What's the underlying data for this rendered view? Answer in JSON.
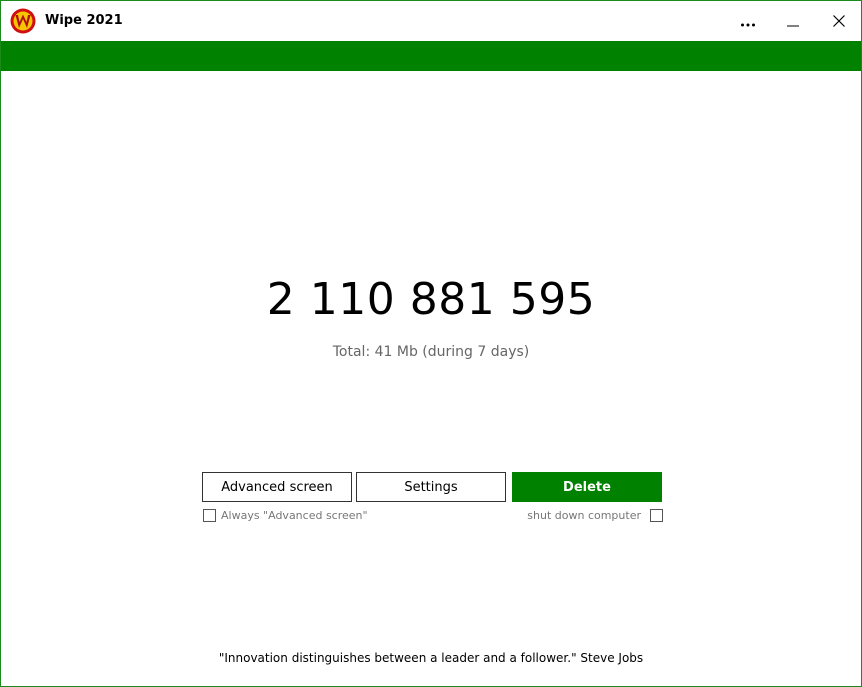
{
  "window": {
    "title": "Wipe 2021",
    "logo_icon": "wipe-logo-icon",
    "controls": {
      "more_icon": "more-icon",
      "minimize_icon": "minimize-icon",
      "close_icon": "close-icon"
    }
  },
  "colors": {
    "accent": "#008200",
    "border": "#1a8a1a",
    "secondary_text": "#666666"
  },
  "main": {
    "counter": "2 110 881 595",
    "total": "Total: 41 Mb (during 7 days)"
  },
  "actions": {
    "advanced_label": "Advanced screen",
    "settings_label": "Settings",
    "delete_label": "Delete"
  },
  "options": {
    "always_advanced_label": "Always \"Advanced screen\"",
    "always_advanced_checked": false,
    "shutdown_label": "shut down computer",
    "shutdown_checked": false
  },
  "footer": {
    "quote": "\"Innovation distinguishes between a leader and a follower.\" Steve Jobs"
  }
}
